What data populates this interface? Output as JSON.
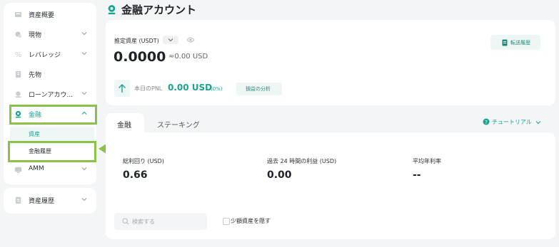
{
  "sidebar": {
    "items": [
      {
        "label": "資産概要",
        "icon": "asset-overview-icon"
      },
      {
        "label": "現物",
        "icon": "spot-icon"
      },
      {
        "label": "レバレッジ",
        "icon": "leverage-icon"
      },
      {
        "label": "先物",
        "icon": "futures-icon"
      },
      {
        "label": "ローンアカウ...",
        "icon": "loan-icon"
      },
      {
        "label": "金融",
        "icon": "finance-icon"
      },
      {
        "label": "AMM",
        "icon": "amm-icon"
      }
    ],
    "finance_sub": {
      "assets": "資産",
      "history": "金融履歴"
    },
    "asset_history": "資産履歴"
  },
  "header": {
    "title": "金融アカウント"
  },
  "summary": {
    "estimated_label": "推定資産 (USDT)",
    "amount": "0.0000",
    "approx": "≈0.00 USD",
    "transfer_history": "転送履歴",
    "today_pnl_label": "本日のPNL",
    "pnl_value": "0.00 USD",
    "pnl_percent": "(0%)",
    "pnl_analysis": "損益の分析"
  },
  "tabs": [
    {
      "label": "金融",
      "active": true
    },
    {
      "label": "ステーキング",
      "active": false
    }
  ],
  "tutorial": "チュートリアル",
  "stats": [
    {
      "label": "総利回り (USD)",
      "value": "0.66"
    },
    {
      "label": "過去 24 時間の利益 (USD)",
      "value": "0.00"
    },
    {
      "label": "平均年利率",
      "value": "--"
    }
  ],
  "search": {
    "placeholder": "検索する"
  },
  "hide_small": "少額資産を隠す",
  "colors": {
    "accent": "#1aa38f",
    "highlight": "#8bc34a",
    "background": "#f4f5f6"
  }
}
